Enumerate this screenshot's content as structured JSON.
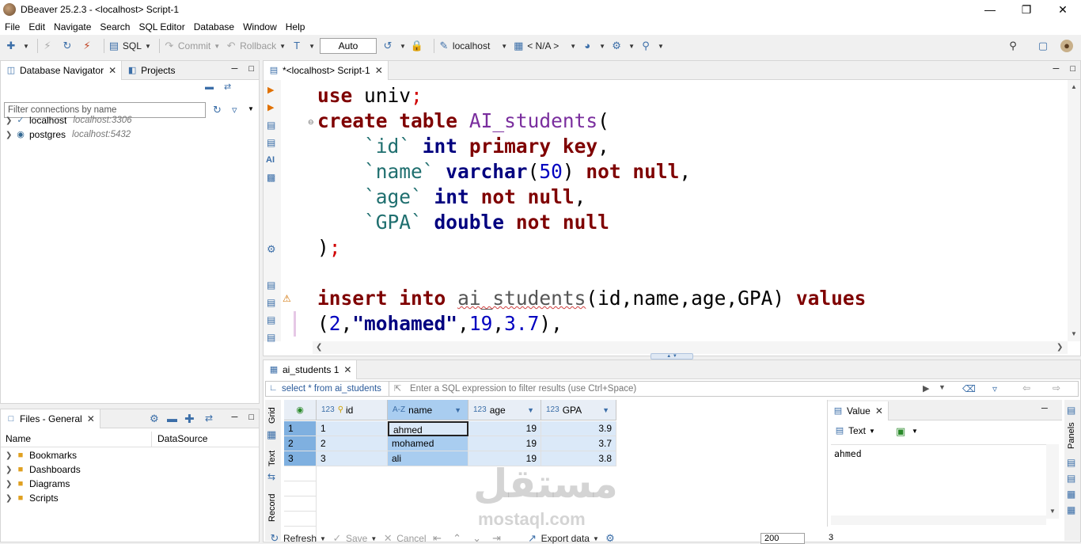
{
  "window": {
    "title": "DBeaver 25.2.3 - <localhost> Script-1"
  },
  "menu": [
    "File",
    "Edit",
    "Navigate",
    "Search",
    "SQL Editor",
    "Database",
    "Window",
    "Help"
  ],
  "toolbar": {
    "sql_label": "SQL",
    "commit_label": "Commit",
    "rollback_label": "Rollback",
    "auto_label": "Auto",
    "connection_label": "localhost",
    "schema_label": "< N/A >"
  },
  "navigator": {
    "tab_label": "Database Navigator",
    "projects_tab_label": "Projects",
    "filter_placeholder": "Filter connections by name",
    "connections": [
      {
        "name": "localhost",
        "host": "localhost:3306"
      },
      {
        "name": "postgres",
        "host": "localhost:5432"
      }
    ]
  },
  "files": {
    "tab_label": "Files - General",
    "columns": [
      "Name",
      "DataSource"
    ],
    "items": [
      "Bookmarks",
      "Dashboards",
      "Diagrams",
      "Scripts"
    ]
  },
  "editor": {
    "tab_label": "*<localhost> Script-1",
    "side_ai_label": "AI"
  },
  "results": {
    "tab_label": "ai_students 1",
    "query_label": "select * from ai_students",
    "filter_placeholder": "Enter a SQL expression to filter results (use Ctrl+Space)",
    "side_tabs": [
      "Grid",
      "Text",
      "Record"
    ],
    "columns": [
      {
        "type": "123",
        "name": "id"
      },
      {
        "type": "A-Z",
        "name": "name"
      },
      {
        "type": "123",
        "name": "age"
      },
      {
        "type": "123",
        "name": "GPA"
      }
    ],
    "rows": [
      {
        "n": "1",
        "id": "1",
        "name": "ahmed",
        "age": "19",
        "gpa": "3.9"
      },
      {
        "n": "2",
        "id": "2",
        "name": "mohamed",
        "age": "19",
        "gpa": "3.7"
      },
      {
        "n": "3",
        "id": "3",
        "name": "ali",
        "age": "19",
        "gpa": "3.8"
      }
    ],
    "value_panel": {
      "tab_label": "Value",
      "mode_label": "Text",
      "content": "ahmed",
      "side_label": "Panels"
    },
    "bottom": {
      "refresh_label": "Refresh",
      "save_label": "Save",
      "cancel_label": "Cancel",
      "export_label": "Export data",
      "fetch_size": "200",
      "row_count": "3"
    }
  },
  "watermark": {
    "arabic": "مستقل",
    "latin": "mostaql.com"
  }
}
